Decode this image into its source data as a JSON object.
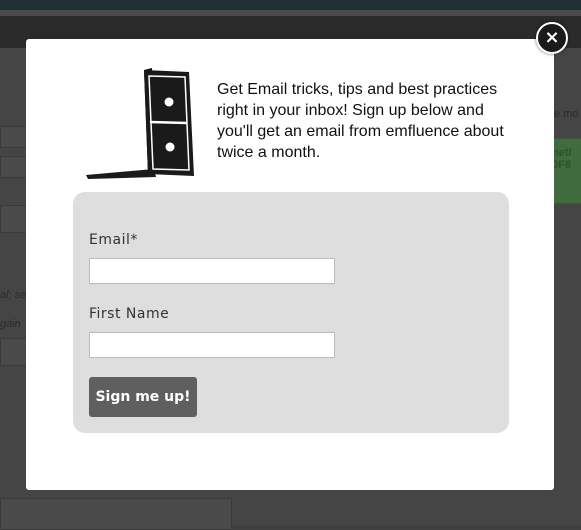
{
  "background": {
    "partial_text_right_top": "e mo",
    "partial_text_right_green_1": "net/",
    "partial_text_right_green_2": "0F8",
    "partial_text_left_1": "al; se",
    "partial_text_left_2": "gain"
  },
  "modal": {
    "close_label": "×",
    "intro_text": "Get Email tricks, tips and best practices right in your inbox! Sign up below and you'll get an email from emfluence about twice a month.",
    "form": {
      "email_label": "Email*",
      "email_value": "",
      "first_name_label": "First Name",
      "first_name_value": "",
      "submit_label": "Sign me up!"
    }
  },
  "colors": {
    "modal_bg": "#ffffff",
    "form_bg": "#dedede",
    "button_bg": "#5f5f5f",
    "overlay": "#454545"
  }
}
